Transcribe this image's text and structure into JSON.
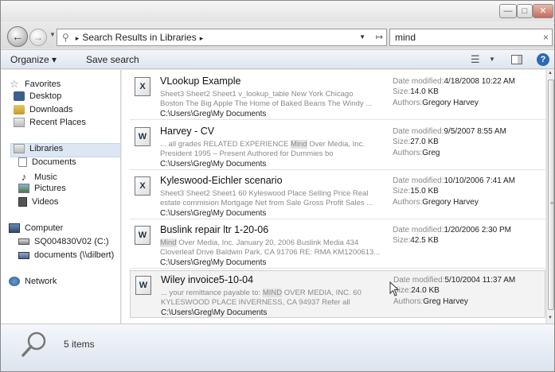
{
  "window": {
    "title": "",
    "controls": {
      "minimize": "—",
      "maximize": "□",
      "close": "✕"
    }
  },
  "address": {
    "path": "Search Results in Libraries",
    "sep": "▸"
  },
  "search": {
    "value": "mind",
    "clear": "×"
  },
  "toolbar": {
    "organize": "Organize ▾",
    "save_search": "Save search",
    "help": "?"
  },
  "nav": {
    "favorites": {
      "label": "Favorites",
      "items": [
        "Desktop",
        "Downloads",
        "Recent Places"
      ]
    },
    "libraries": {
      "label": "Libraries",
      "items": [
        "Documents",
        "Music",
        "Pictures",
        "Videos"
      ]
    },
    "computer": {
      "label": "Computer",
      "items": [
        "SQ004830V02 (C:)",
        "documents (\\\\dilbert)"
      ]
    },
    "network": {
      "label": "Network"
    }
  },
  "meta_labels": {
    "date": "Date modified:",
    "size": "Size:",
    "authors": "Authors:"
  },
  "results": [
    {
      "icon": "excel-file-icon",
      "icon_glyph": "X",
      "name": "VLookup Example",
      "snippet1": "Sheet3 Sheet2 Sheet1 v_lookup_table New York Chicago",
      "snippet2": "Boston The Big Apple The Home of Baked Beans The Windy ...",
      "path": "C:\\Users\\Greg\\My Documents",
      "date": "4/18/2008 10:22 AM",
      "size": "14.0 KB",
      "authors": "Gregory Harvey"
    },
    {
      "icon": "word-file-icon",
      "icon_glyph": "W",
      "name": "Harvey - CV",
      "snippet1": "... all grades RELATED EXPERIENCE Mind Over Media, Inc.",
      "snippet2": "President 1995 – Present Authored for Dummies bo",
      "path": "C:\\Users\\Greg\\My Documents",
      "date": "9/5/2007 8:55 AM",
      "size": "27.0 KB",
      "authors": "Greg"
    },
    {
      "icon": "excel-file-icon",
      "icon_glyph": "X",
      "name": "Kyleswood-Eichler scenario",
      "snippet1": "Sheet3 Sheet2 Sheet1 60 Kyleswood Place Selling Price Real",
      "snippet2": "estate commision Mortgage Net from Sale Gross Profit Sales ...",
      "path": "C:\\Users\\Greg\\My Documents",
      "date": "10/10/2006 7:41 AM",
      "size": "15.0 KB",
      "authors": "Gregory Harvey"
    },
    {
      "icon": "word-file-icon",
      "icon_glyph": "W",
      "name": "Buslink repair ltr 1-20-06",
      "snippet1": "Mind Over Media, Inc. January 20, 2006 Buslink Media 434",
      "snippet2": "Cloverleaf Drive Baldwin Park, CA 91706 RE: RMA KM1200613...",
      "path": "C:\\Users\\Greg\\My Documents",
      "date": "1/20/2006 2:30 PM",
      "size": "42.5 KB",
      "authors": ""
    },
    {
      "icon": "word-file-icon",
      "icon_glyph": "W",
      "name": "Wiley invoice5-10-04",
      "snippet1": "... your remittance payable to: MIND OVER MEDIA, INC. 60",
      "snippet2": "KYLESWOOD PLACE INVERNESS, CA 94937 Refer all question...",
      "path": "C:\\Users\\Greg\\My Documents",
      "date": "5/10/2004 11:37 AM",
      "size": "24.0 KB",
      "authors": "Greg Harvey"
    }
  ],
  "status": {
    "count": "5 items"
  }
}
